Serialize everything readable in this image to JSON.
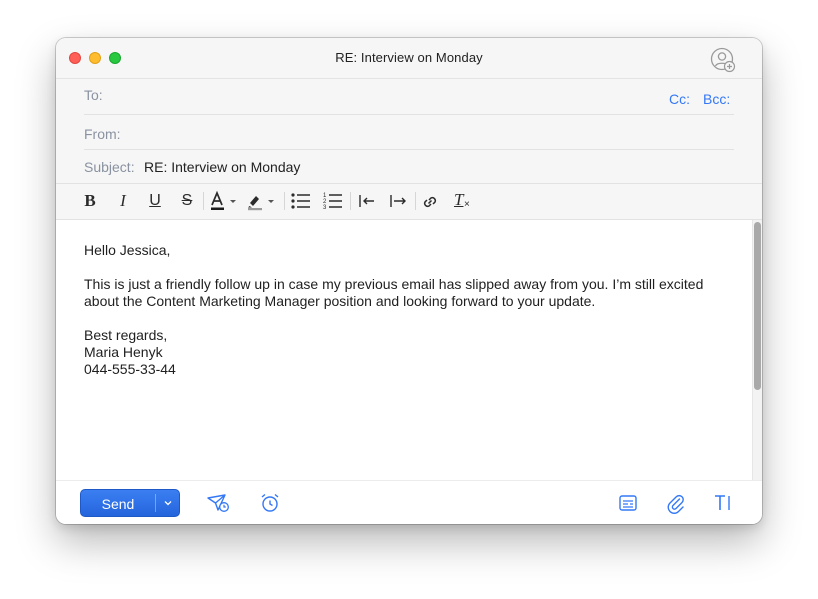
{
  "window": {
    "title": "RE: Interview on Monday"
  },
  "header": {
    "to_label": "To:",
    "from_label": "From:",
    "subject_label": "Subject:",
    "subject_value": "RE: Interview on Monday",
    "cc_label": "Cc:",
    "bcc_label": "Bcc:"
  },
  "toolbar": {
    "bold": "B",
    "italic": "I",
    "underline": "U",
    "strike": "S",
    "font_color_letter": "A",
    "clear_format": "T"
  },
  "body": {
    "greeting": "Hello Jessica,",
    "paragraph": "This is just a friendly follow up in case my previous email has slipped away from you. I’m still excited about the Content Marketing Manager position and looking forward to your update.",
    "signoff": "Best regards,",
    "name": "Maria Henyk",
    "phone": "044-555-33-44"
  },
  "footer": {
    "send_label": "Send"
  },
  "colors": {
    "accent": "#3478f6",
    "send_button": "#2a6ee6",
    "label_gray": "#8a92a1"
  },
  "icons": [
    "add-contact-icon",
    "text-color-icon",
    "highlight-icon",
    "bullet-list-icon",
    "numbered-list-icon",
    "outdent-icon",
    "indent-icon",
    "link-icon",
    "clear-format-icon",
    "send-later-icon",
    "reminder-alarm-icon",
    "template-icon",
    "attachment-icon",
    "text-format-icon",
    "chevron-down-icon"
  ]
}
